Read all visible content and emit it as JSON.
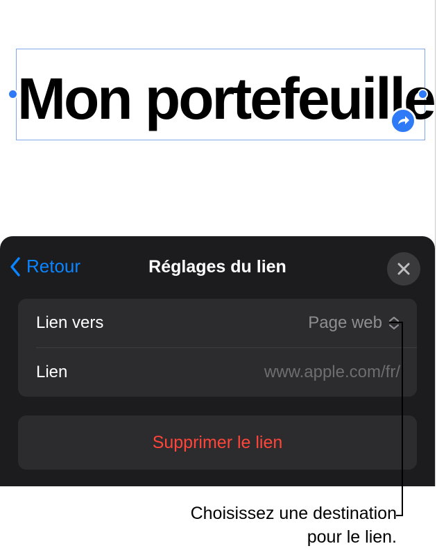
{
  "document": {
    "title": "Mon portefeuille"
  },
  "link_settings": {
    "back_label": "Retour",
    "title": "Réglages du lien",
    "rows": [
      {
        "label": "Lien vers",
        "value": "Page web"
      },
      {
        "label": "Lien",
        "value": "www.apple.com/fr/"
      }
    ],
    "delete_label": "Supprimer le lien"
  },
  "callout": {
    "line1": "Choisissez une destination",
    "line2": "pour le lien."
  },
  "icons": {
    "back": "chevron-left-icon",
    "close": "close-icon",
    "popup": "chevron-up-down-icon",
    "link_badge": "link-arrow-icon"
  },
  "colors": {
    "accent": "#0a84ff",
    "selection": "#2f7af6",
    "destructive": "#ff453a",
    "sheet_background": "#1c1c1e",
    "group_background": "#2c2c2e"
  }
}
